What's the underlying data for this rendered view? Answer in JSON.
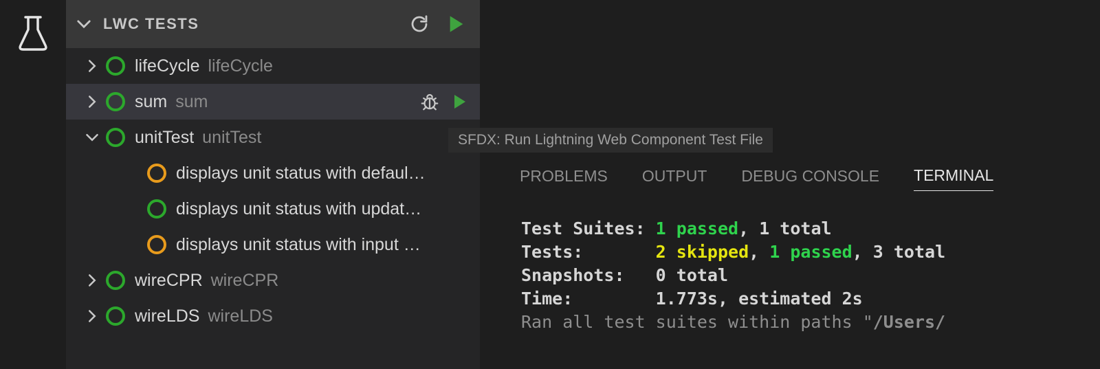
{
  "sidebar": {
    "section_title": "LWC TESTS",
    "items": [
      {
        "label": "lifeCycle",
        "desc": "lifeCycle",
        "status": "pass",
        "expanded": false,
        "depth": 0
      },
      {
        "label": "sum",
        "desc": "sum",
        "status": "pass",
        "expanded": false,
        "depth": 0,
        "hover": true
      },
      {
        "label": "unitTest",
        "desc": "unitTest",
        "status": "pass",
        "expanded": true,
        "depth": 0
      },
      {
        "label": "displays unit status with defaul…",
        "status": "pend",
        "depth": 2,
        "guide": true
      },
      {
        "label": "displays unit status with updat…",
        "status": "pass",
        "depth": 2,
        "guide": true
      },
      {
        "label": "displays unit status with input …",
        "status": "pend",
        "depth": 2,
        "guide": true
      },
      {
        "label": "wireCPR",
        "desc": "wireCPR",
        "status": "pass",
        "expanded": false,
        "depth": 0
      },
      {
        "label": "wireLDS",
        "desc": "wireLDS",
        "status": "pass",
        "expanded": false,
        "depth": 0
      }
    ]
  },
  "tooltip": "SFDX: Run Lightning Web Component Test File",
  "panel": {
    "tabs": [
      "PROBLEMS",
      "OUTPUT",
      "DEBUG CONSOLE",
      "TERMINAL"
    ],
    "active_tab": "TERMINAL",
    "terminal": {
      "l1_label": "Test Suites: ",
      "l1_passed": "1 passed",
      "l1_rest": ", 1 total",
      "l2_label": "Tests:       ",
      "l2_skipped": "2 skipped",
      "l2_sep": ", ",
      "l2_passed": "1 passed",
      "l2_rest": ", 3 total",
      "l3": "Snapshots:   0 total",
      "l4": "Time:        1.773s, estimated 2s",
      "l5_a": "Ran all test suites within paths \"",
      "l5_b": "/Users/"
    }
  }
}
